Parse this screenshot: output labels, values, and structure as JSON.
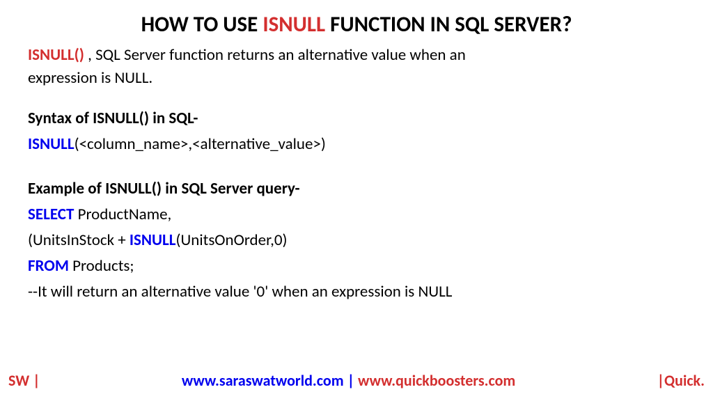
{
  "title": {
    "part1": "HOW TO USE ",
    "highlight": "ISNULL",
    "part2": " FUNCTION IN SQL SERVER?"
  },
  "intro": {
    "keyword": "ISNULL()",
    "text1": " , SQL Server function returns an alternative value when an",
    "text2": "expression is NULL."
  },
  "syntax": {
    "heading": "Syntax of ISNULL() in SQL-",
    "keyword": "ISNULL",
    "params": "(<column_name>,<alternative_value>)"
  },
  "example": {
    "heading": "Example of ISNULL() in SQL Server query-",
    "line1_kw": "SELECT",
    "line1_rest": " ProductName,",
    "line2_pre": "(UnitsInStock + ",
    "line2_kw": "ISNULL",
    "line2_post": "(UnitsOnOrder,0)",
    "line3_kw": "FROM",
    "line3_rest": " Products;",
    "comment": "--It will return an alternative value '0' when an expression is NULL"
  },
  "footer": {
    "left": "SW |",
    "center_blue": "www.saraswatworld.com",
    "center_sep": " | ",
    "center_red": "www.quickboosters.com",
    "right": "|Quick."
  }
}
